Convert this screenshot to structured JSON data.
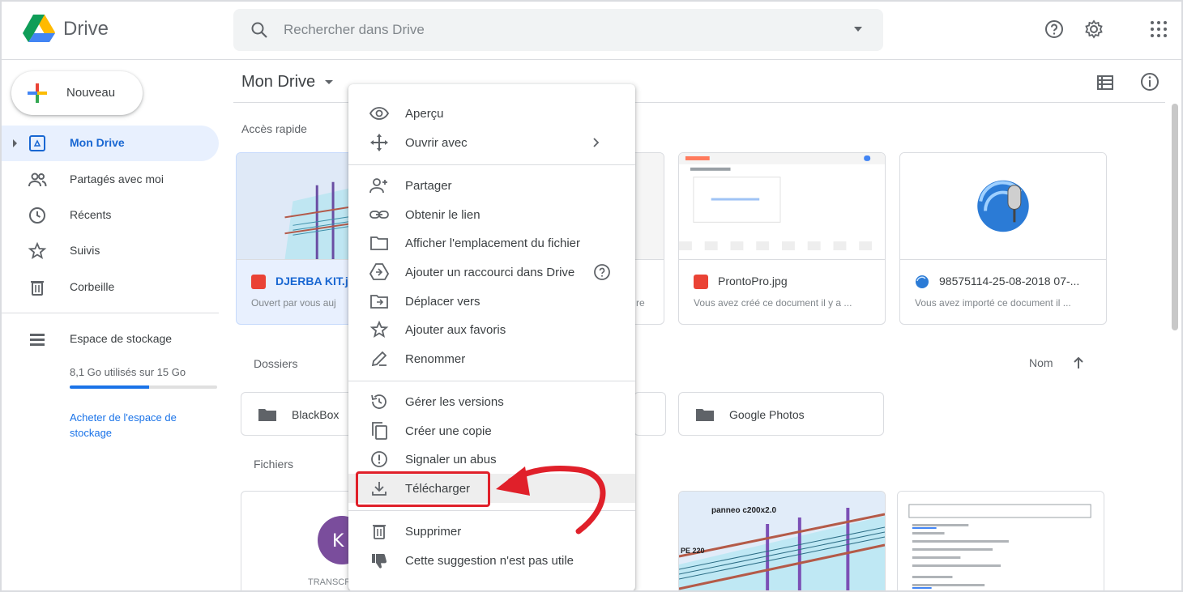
{
  "app": {
    "name": "Drive"
  },
  "search": {
    "placeholder": "Rechercher dans Drive"
  },
  "header_icons": [
    "help-icon",
    "settings-icon",
    "apps-icon"
  ],
  "sidebar": {
    "new_label": "Nouveau",
    "items": [
      {
        "label": "Mon Drive",
        "icon": "my-drive-icon",
        "active": true
      },
      {
        "label": "Partagés avec moi",
        "icon": "shared-icon"
      },
      {
        "label": "Récents",
        "icon": "clock-icon"
      },
      {
        "label": "Suivis",
        "icon": "star-icon"
      },
      {
        "label": "Corbeille",
        "icon": "trash-icon"
      }
    ],
    "storage": {
      "label": "Espace de stockage",
      "usage": "8,1 Go utilisés sur 15 Go",
      "fraction_used": 0.54,
      "buy_link": "Acheter de l'espace de stockage"
    }
  },
  "main": {
    "breadcrumb": "Mon Drive",
    "quick_access_label": "Accès rapide",
    "quick_access": [
      {
        "name": "DJERBA KIT.jp",
        "sub": "Ouvert par vous auj",
        "type": "image"
      },
      {
        "name": "",
        "sub": "re",
        "type": "image"
      },
      {
        "name": "ProntoPro.jpg",
        "sub": "Vous avez créé ce document il y a ...",
        "type": "image"
      },
      {
        "name": "98575114-25-08-2018 07-...",
        "sub": "Vous avez importé ce document il ...",
        "type": "web"
      }
    ],
    "folders_label": "Dossiers",
    "sort": {
      "label": "Nom",
      "direction": "ascending"
    },
    "folders": [
      {
        "name": "BlackBox"
      },
      {
        "name": "Google Photos"
      }
    ],
    "files_label": "Fichiers",
    "file_thumb_texts": [
      "TRANSCR",
      "panneo c200x2.0",
      "PE 220"
    ]
  },
  "context_menu": {
    "items": [
      {
        "label": "Aperçu",
        "icon": "eye-icon"
      },
      {
        "label": "Ouvrir avec",
        "icon": "open-with-icon",
        "submenu": true
      },
      {
        "label": "Partager",
        "icon": "share-person-icon"
      },
      {
        "label": "Obtenir le lien",
        "icon": "link-icon"
      },
      {
        "label": "Afficher l'emplacement du fichier",
        "icon": "folder-location-icon"
      },
      {
        "label": "Ajouter un raccourci dans Drive",
        "icon": "drive-shortcut-icon",
        "help": true
      },
      {
        "label": "Déplacer vers",
        "icon": "move-to-icon"
      },
      {
        "label": "Ajouter aux favoris",
        "icon": "star-outline-icon"
      },
      {
        "label": "Renommer",
        "icon": "rename-icon"
      },
      {
        "label": "Gérer les versions",
        "icon": "history-icon"
      },
      {
        "label": "Créer une copie",
        "icon": "copy-icon"
      },
      {
        "label": "Signaler un abus",
        "icon": "report-icon"
      },
      {
        "label": "Télécharger",
        "icon": "download-icon",
        "highlighted": true
      },
      {
        "label": "Supprimer",
        "icon": "delete-icon"
      },
      {
        "label": "Cette suggestion n'est pas utile",
        "icon": "thumb-down-icon"
      }
    ]
  },
  "annotation": {
    "highlight_color": "#e0202a",
    "target": "Télécharger"
  },
  "colors": {
    "accent": "#1a73e8",
    "active_bg": "#e8f0fe",
    "active_text": "#1967d2",
    "file_red": "#ea4335"
  }
}
